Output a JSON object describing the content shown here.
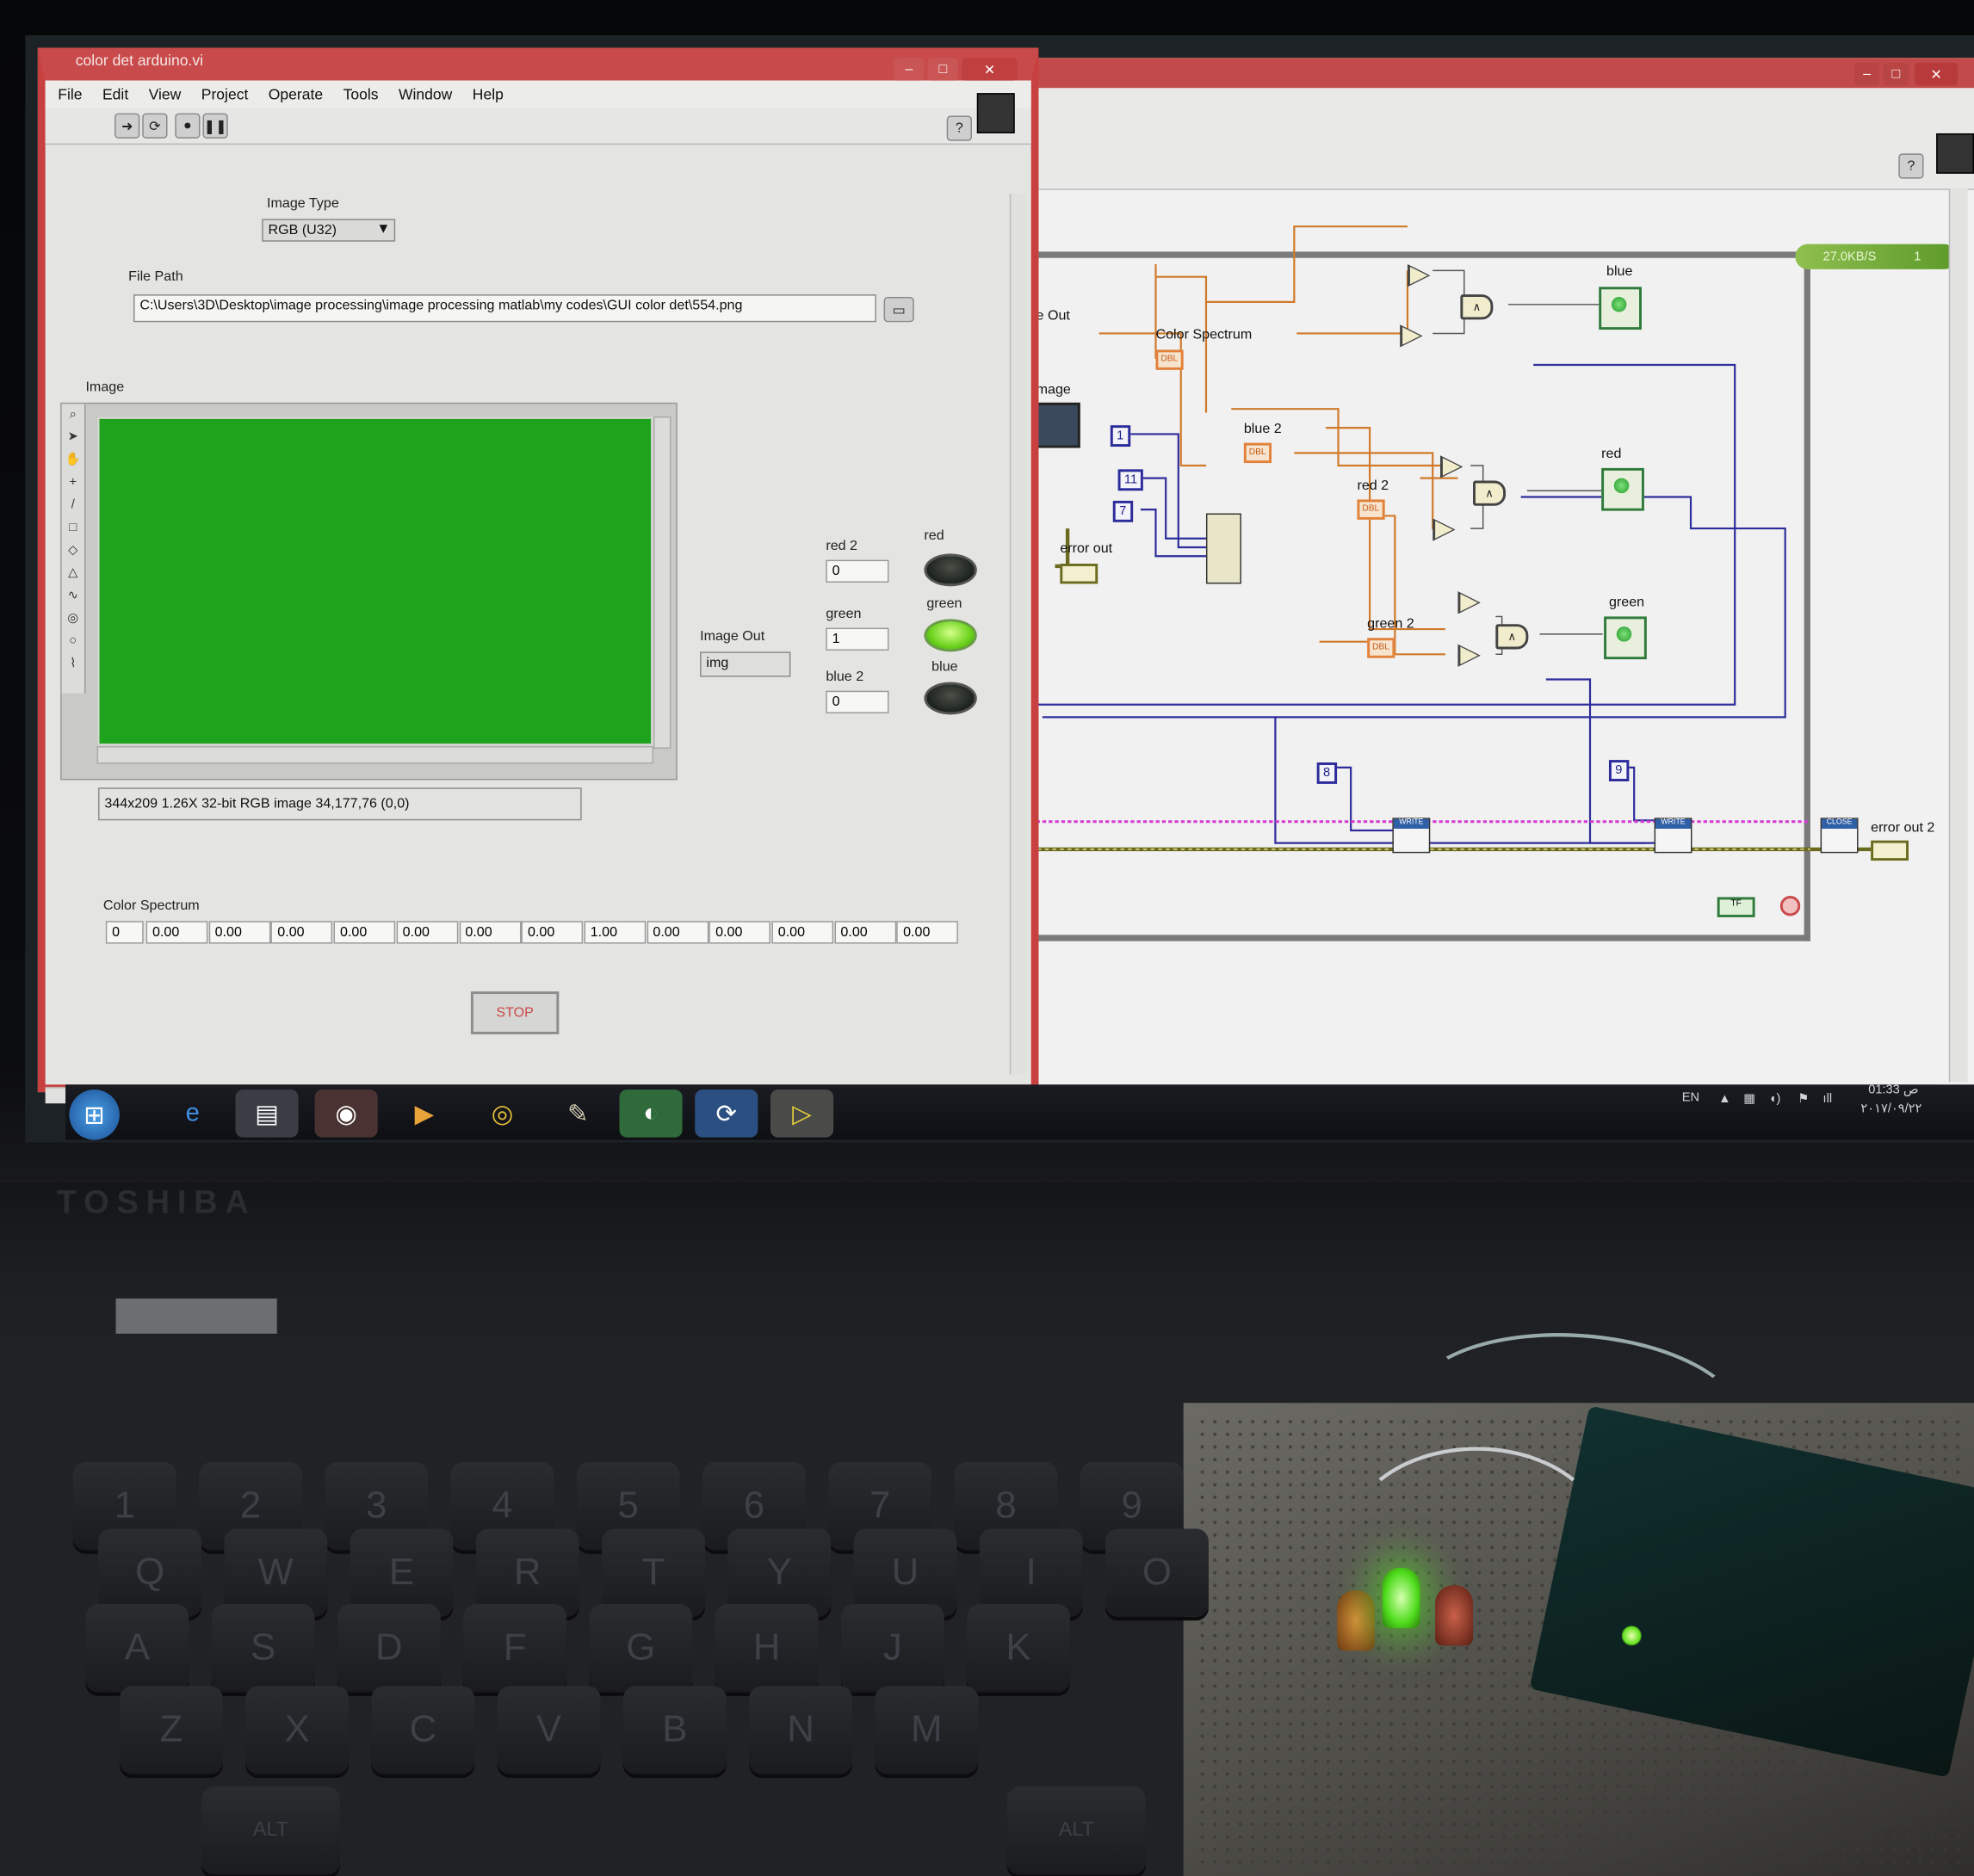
{
  "front_panel": {
    "title": "color det arduino.vi",
    "menu": [
      "File",
      "Edit",
      "View",
      "Project",
      "Operate",
      "Tools",
      "Window",
      "Help"
    ],
    "image_type_label": "Image Type",
    "image_type_value": "RGB (U32)",
    "file_path_label": "File Path",
    "file_path_value": "C:\\Users\\3D\\Desktop\\image processing\\image processing matlab\\my codes\\GUI color det\\554.png",
    "image_label": "Image",
    "image_info": "344x209 1.26X 32-bit RGB image 34,177,76    (0,0)",
    "image_out_label": "Image Out",
    "image_out_value": "img",
    "red2_label": "red 2",
    "red2_value": "0",
    "green_label": "green",
    "green_value": "1",
    "blue2_label": "blue 2",
    "blue2_value": "0",
    "led_red_label": "red",
    "led_green_label": "green",
    "led_blue_label": "blue",
    "led_states": {
      "red": false,
      "green": true,
      "blue": false
    },
    "color_spectrum_label": "Color Spectrum",
    "color_spectrum_index": "0",
    "color_spectrum_values": [
      "0.00",
      "0.00",
      "0.00",
      "0.00",
      "0.00",
      "0.00",
      "0.00",
      "1.00",
      "0.00",
      "0.00",
      "0.00",
      "0.00",
      "0.00"
    ],
    "stop_label": "STOP",
    "displayed_image_color": "#1fa21c"
  },
  "block_diagram": {
    "rate_badge": "27.0KB/S",
    "rate_badge_count": "1",
    "labels": {
      "image_out": "e Out",
      "image": "Image",
      "color_spectrum": "Color Spectrum",
      "blue2": "blue 2",
      "red2": "red 2",
      "green2": "green 2",
      "blue": "blue",
      "red": "red",
      "green": "green",
      "error_out": "error out",
      "error_out2": "error out 2"
    },
    "constants": [
      "1",
      "11",
      "7",
      "8",
      "9"
    ],
    "terminal_type": "DBL",
    "write_label": "WRITE",
    "close_label": "CLOSE"
  },
  "taskbar": {
    "language": "EN",
    "time": "01:33 ص",
    "date": "٢٠١٧/٠٩/٢٢"
  },
  "laptop": {
    "brand": "TOSHIBA",
    "keys_row1": [
      "1",
      "2",
      "3",
      "4",
      "5",
      "6",
      "7",
      "8",
      "9"
    ],
    "keys_row2": [
      "Q",
      "W",
      "E",
      "R",
      "T",
      "Y",
      "U",
      "I",
      "O"
    ],
    "keys_row3": [
      "A",
      "S",
      "D",
      "F",
      "G",
      "H",
      "J",
      "K"
    ],
    "keys_row4": [
      "Z",
      "X",
      "C",
      "V",
      "B",
      "N",
      "M"
    ],
    "alt_label": "ALT"
  }
}
